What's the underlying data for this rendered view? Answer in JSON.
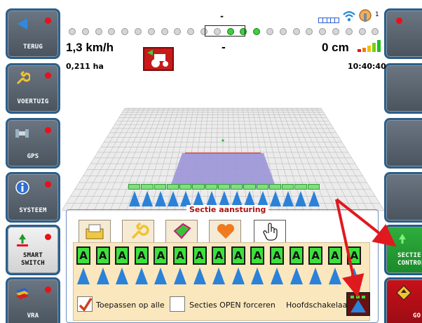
{
  "left_buttons": [
    {
      "label": "TERUG",
      "icon": "back-arrow-icon"
    },
    {
      "label": "VOERTUIG",
      "icon": "wrench-icon"
    },
    {
      "label": "GPS",
      "icon": "satellite-icon"
    },
    {
      "label": "SYSTEEM",
      "icon": "info-icon"
    },
    {
      "label": "SMART\nSWITCH",
      "icon": "smart-switch-icon"
    },
    {
      "label": "VRA",
      "icon": "vra-layers-icon"
    }
  ],
  "right_buttons": [
    {
      "label": ""
    },
    {
      "label": ""
    },
    {
      "label": ""
    },
    {
      "label": ""
    },
    {
      "label": "SECTIE\nCONTROL",
      "icon": "section-control-icon"
    },
    {
      "label": "GO",
      "icon": "go-diamond-icon"
    }
  ],
  "status": {
    "speed": "1,3 km/h",
    "area": "0,211 ha",
    "center_dash_top": "-",
    "center_dash_mid": "-",
    "offset": "0 cm",
    "time": "10:40:40",
    "right_top_number": "1"
  },
  "lightbar": {
    "total": 24,
    "active": [
      12,
      13,
      14
    ]
  },
  "section_panel": {
    "title": "Sectie aansturing",
    "tabs": [
      "folder-icon",
      "wrench-icon",
      "field-icon",
      "heart-icon",
      "hand-pointer-icon"
    ],
    "section_letter": "A",
    "section_count": 15,
    "apply_all_label": "Toepassen op alle",
    "apply_all_checked": true,
    "force_open_label": "Secties OPEN forceren",
    "force_open_checked": false,
    "master_switch_label": "Hoofdschakelaar"
  },
  "colors": {
    "accent_green": "#3de03d",
    "section_blue": "#2b82d8",
    "alert_red": "#e8101a",
    "panel_title_red": "#b01010",
    "arrow_red": "#e0191f"
  }
}
